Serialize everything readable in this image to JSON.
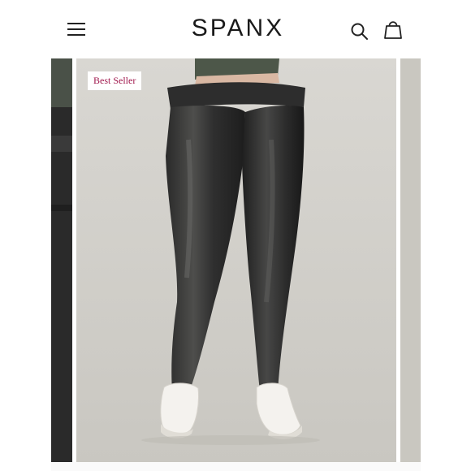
{
  "header": {
    "logo_text": "SPANX",
    "menu_icon": "hamburger-menu-icon",
    "search_icon": "search-icon",
    "bag_icon": "shopping-bag-icon"
  },
  "product": {
    "badge_label": "Best Seller",
    "badge_color": "#a0174c",
    "image_description_icon": "product-photo"
  },
  "colors": {
    "background": "#ffffff",
    "text": "#1a1a1a",
    "photo_backdrop": "#cfcdc8"
  }
}
